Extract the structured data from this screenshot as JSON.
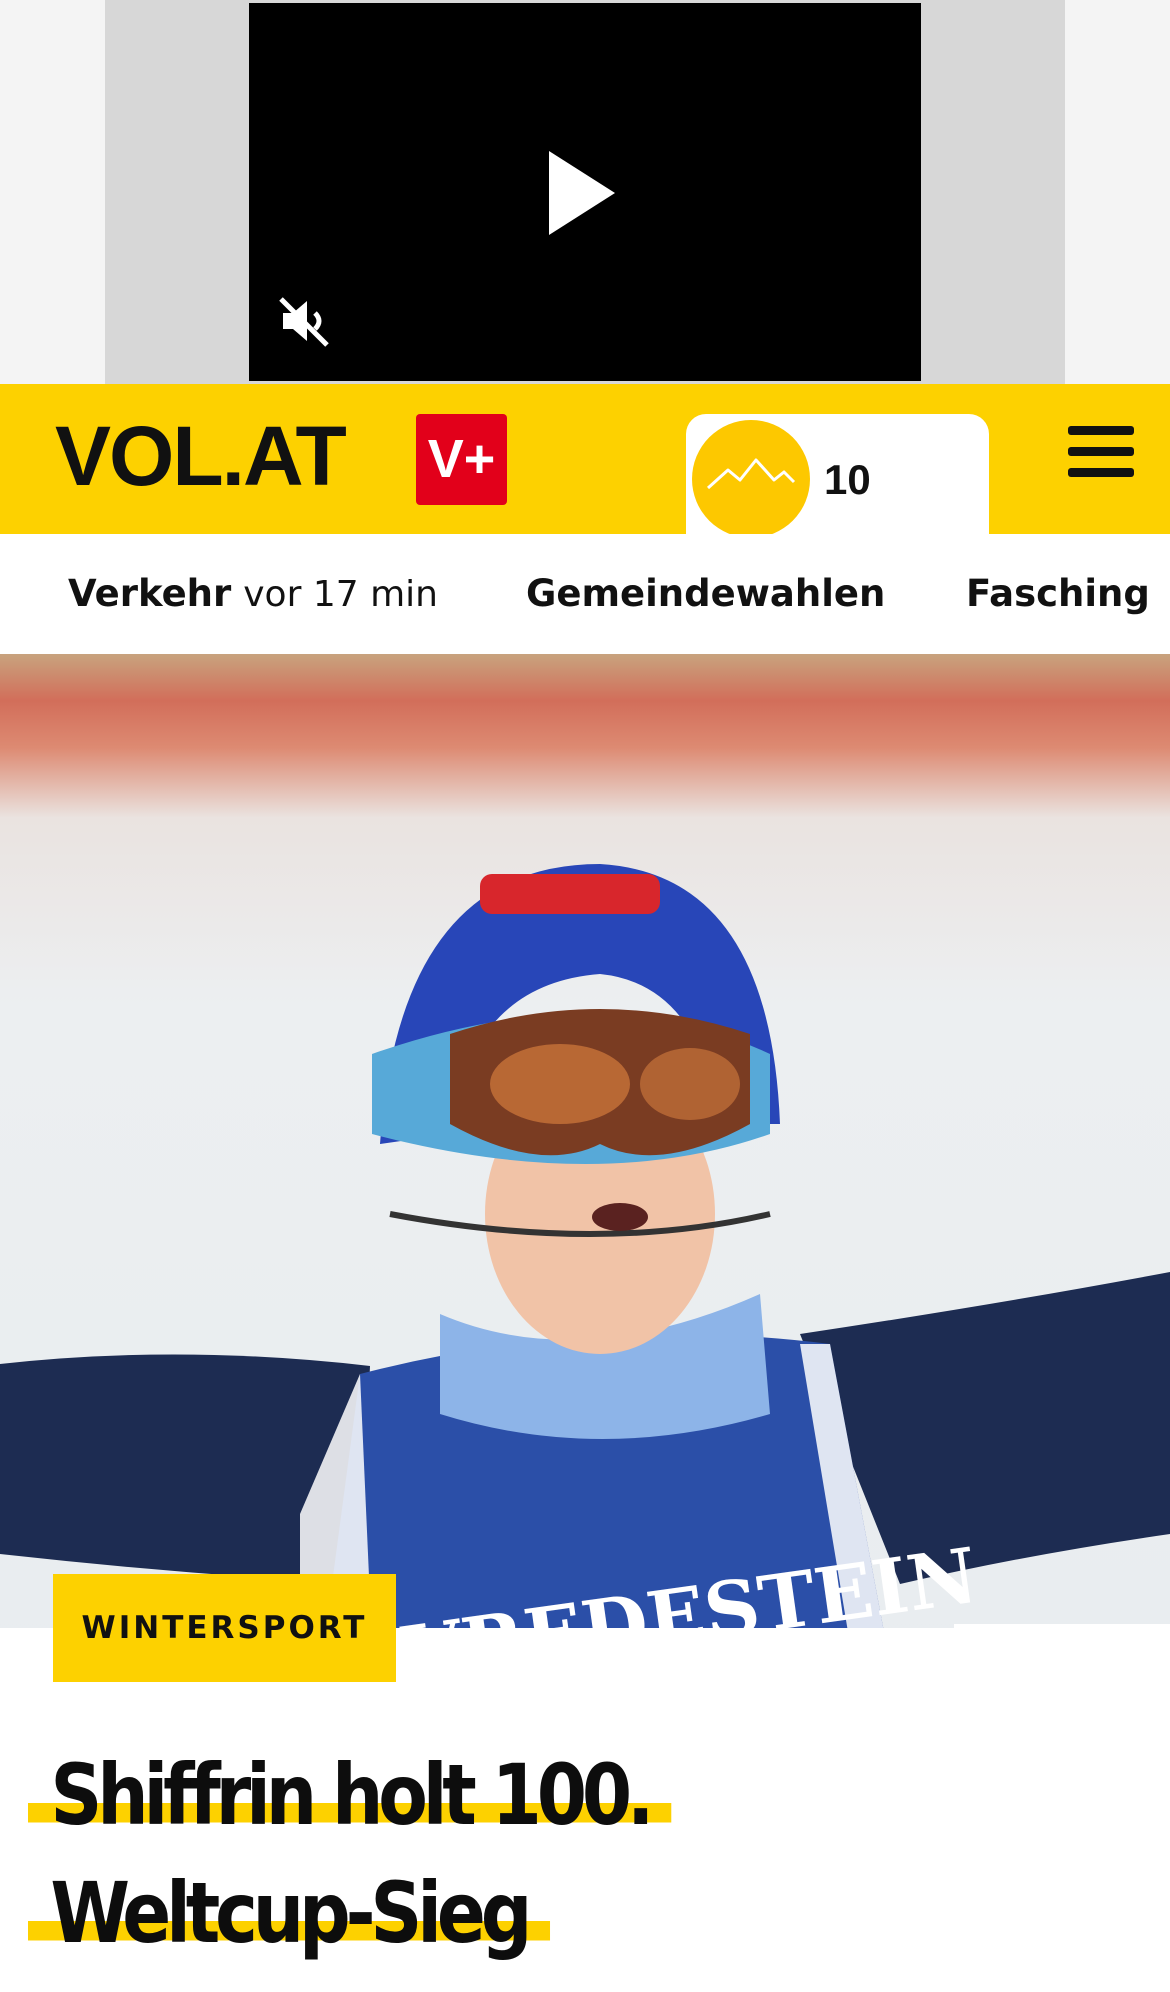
{
  "ad": {
    "play_icon": "play-icon",
    "mute_icon": "speaker-muted-icon"
  },
  "header": {
    "logo": "VOL.AT",
    "vplus_label": "V+",
    "weather": {
      "icon": "mountain-sun-icon",
      "temperature": "10"
    },
    "menu_icon": "hamburger-menu-icon",
    "brand_color": "#fdd100",
    "accent_color": "#e2001a"
  },
  "topics": [
    {
      "label": "Verkehr",
      "time": "vor 17 min"
    },
    {
      "label": "Gemeindewahlen"
    },
    {
      "label": "Fasching"
    }
  ],
  "article": {
    "category": "WINTERSPORT",
    "headline_lines": [
      "Shiffrin holt 100.",
      "Weltcup-Sieg"
    ]
  }
}
